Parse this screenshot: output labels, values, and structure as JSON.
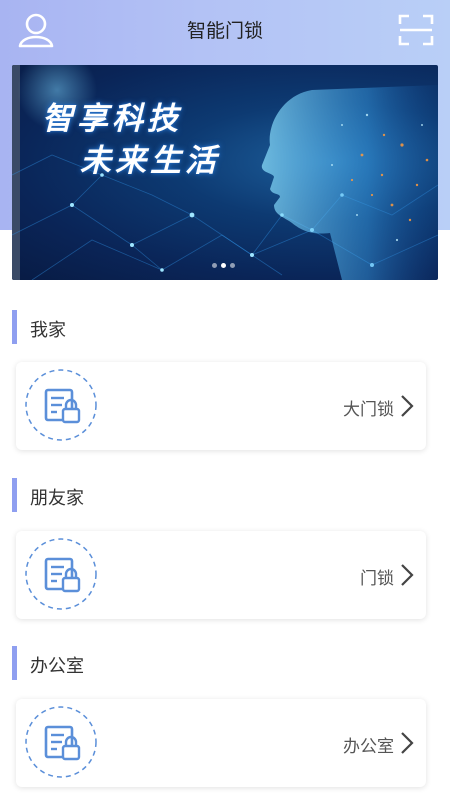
{
  "header": {
    "title": "智能门锁",
    "user_icon": "user-icon",
    "scan_icon": "scan-icon"
  },
  "banner": {
    "headline_line1": "智享科技",
    "headline_line2": "未来生活",
    "page_count": 3,
    "active_page": 2
  },
  "sections": [
    {
      "title": "我家",
      "device": "大门锁"
    },
    {
      "title": "朋友家",
      "device": "门锁"
    },
    {
      "title": "办公室",
      "device": "办公室"
    }
  ],
  "colors": {
    "accent": "#8f9ff0",
    "icon": "#5b8fd9",
    "header_gradient_start": "#a8b4f2",
    "header_gradient_end": "#b9cff7"
  }
}
